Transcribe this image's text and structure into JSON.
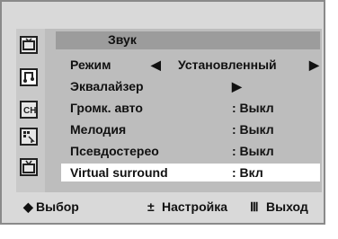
{
  "menu": {
    "title": "Звук",
    "rows": [
      {
        "label": "Режим",
        "value": "Установленный",
        "prefix": "◀",
        "suffix": "▶"
      },
      {
        "label": "Эквалайзер",
        "value": "▶"
      },
      {
        "label": "Громк. авто",
        "value": ": Выкл"
      },
      {
        "label": "Мелодия",
        "value": ": Выкл"
      },
      {
        "label": "Псевдостерео",
        "value": ": Выкл"
      },
      {
        "label": "Virtual surround",
        "value": ": Вкл",
        "selected": true
      }
    ]
  },
  "footer": {
    "select_icon": "◆",
    "select_label": "Выбор",
    "adjust_icon": "±",
    "adjust_label": "Настройка",
    "exit_icon": "Ⅲ",
    "exit_label": "Выход"
  },
  "icons": [
    "tv-icon",
    "music-icon",
    "channel-icon",
    "setup-icon",
    "input-icon"
  ],
  "colors": {
    "menu_bg": "#bdbdbd",
    "title_bg": "#9c9c9c",
    "highlight": "#ffffff"
  }
}
